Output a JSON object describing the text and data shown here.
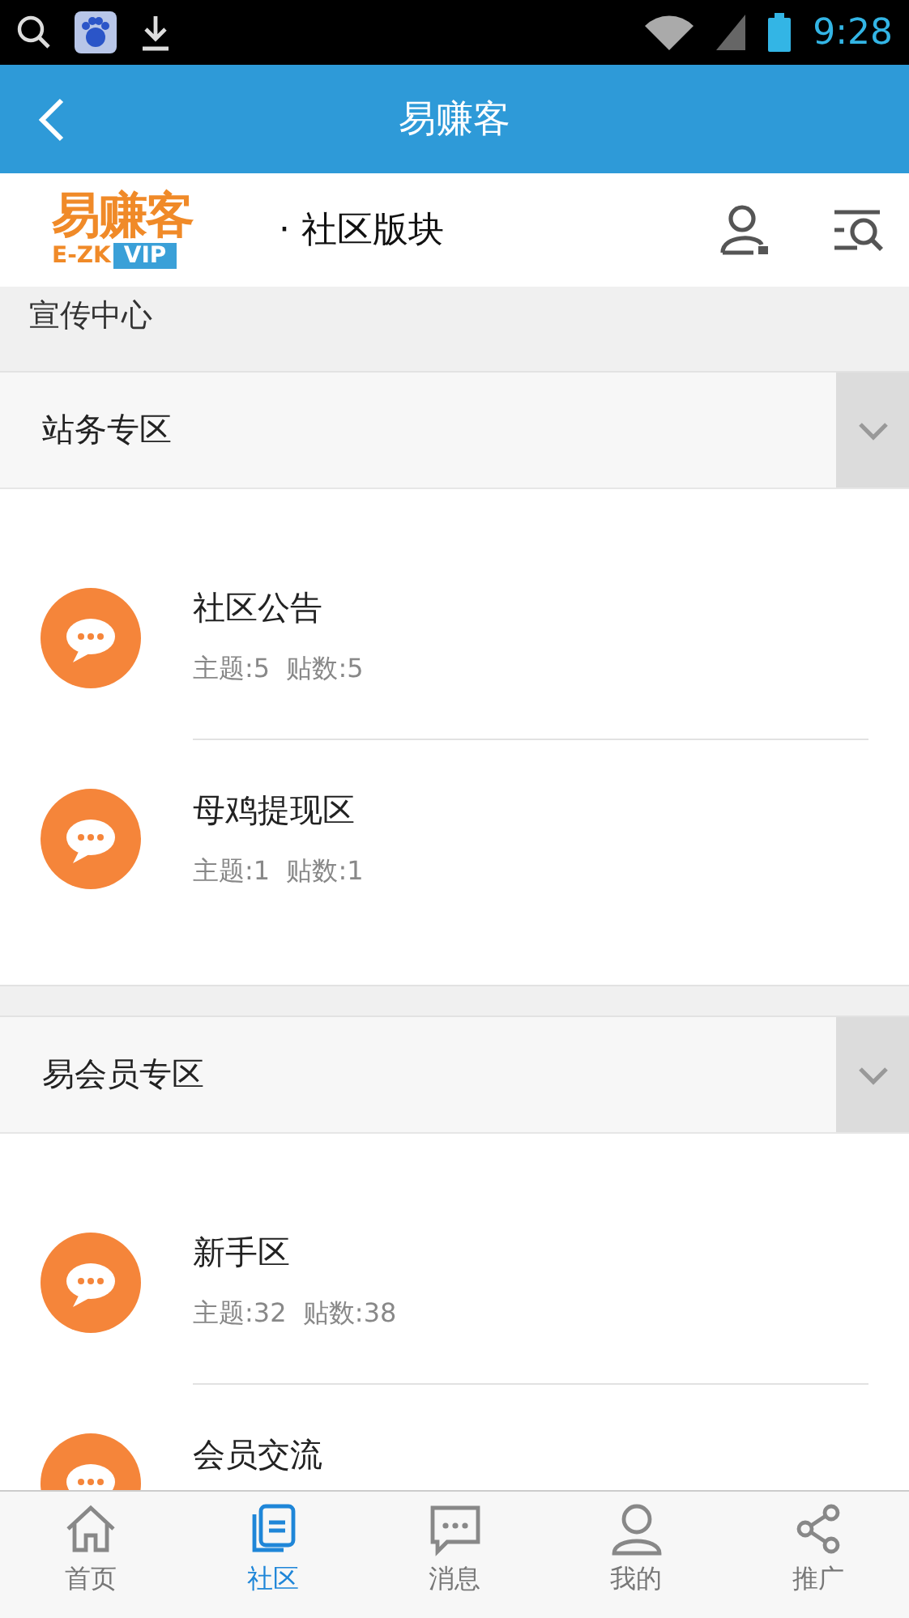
{
  "status_bar": {
    "time": "9:28"
  },
  "app_bar": {
    "title": "易赚客"
  },
  "header": {
    "logo": {
      "name": "易赚客",
      "sub": "E-ZK",
      "badge": "VIP"
    },
    "title": "· 社区版块"
  },
  "group_label": "宣传中心",
  "sections": [
    {
      "title": "站务专区",
      "forums": [
        {
          "name": "社区公告",
          "meta": "主题:5  贴数:5"
        },
        {
          "name": "母鸡提现区",
          "meta": "主题:1  贴数:1"
        }
      ]
    },
    {
      "title": "易会员专区",
      "forums": [
        {
          "name": "新手区",
          "meta": "主题:32  贴数:38"
        },
        {
          "name": "会员交流"
        }
      ]
    }
  ],
  "bottom_nav": [
    {
      "kind": "home",
      "label": "首页",
      "selected": false
    },
    {
      "kind": "docs",
      "label": "社区",
      "selected": true
    },
    {
      "kind": "chat",
      "label": "消息",
      "selected": false
    },
    {
      "kind": "person",
      "label": "我的",
      "selected": false
    },
    {
      "kind": "share",
      "label": "推广",
      "selected": false
    }
  ]
}
